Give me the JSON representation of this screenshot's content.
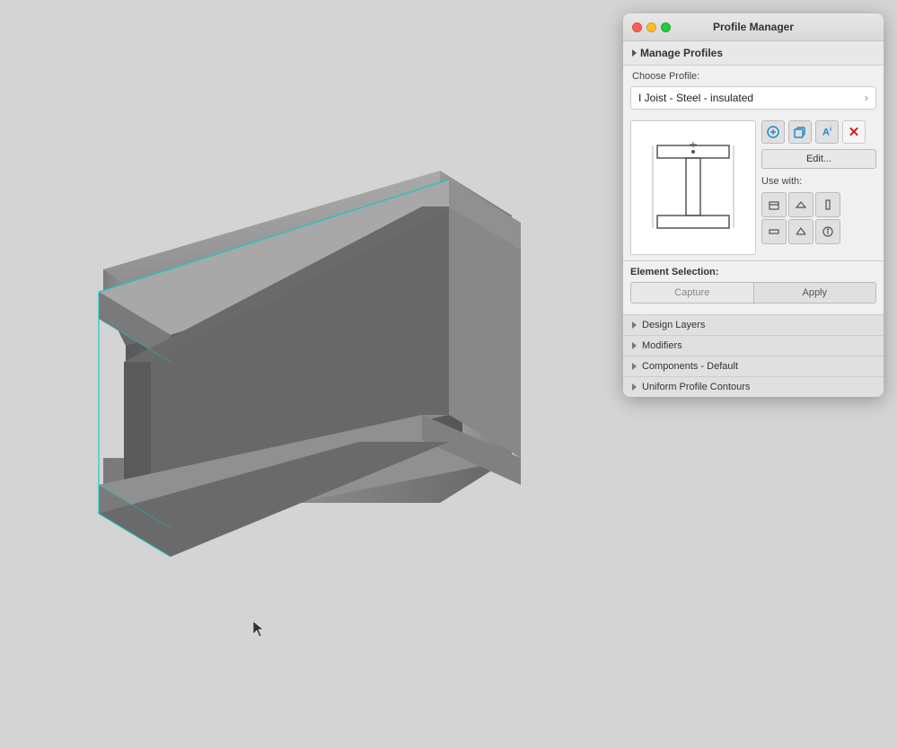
{
  "window": {
    "title": "Profile Manager",
    "trafficLights": [
      "close",
      "minimize",
      "maximize"
    ]
  },
  "panel": {
    "manage_profiles_label": "Manage Profiles",
    "choose_profile_label": "Choose Profile:",
    "selected_profile": "I Joist - Steel - insulated",
    "edit_button_label": "Edit...",
    "use_with_label": "Use with:",
    "element_selection_label": "Element Selection:",
    "capture_button_label": "Capture",
    "apply_button_label": "Apply",
    "collapsible_items": [
      "Design Layers",
      "Modifiers",
      "Components - Default",
      "Uniform Profile Contours"
    ],
    "icons": {
      "add": "⊕",
      "duplicate": "⧉",
      "rename": "Aˢ",
      "delete": "✕"
    }
  },
  "viewport": {
    "background_color": "#d4d4d4"
  }
}
